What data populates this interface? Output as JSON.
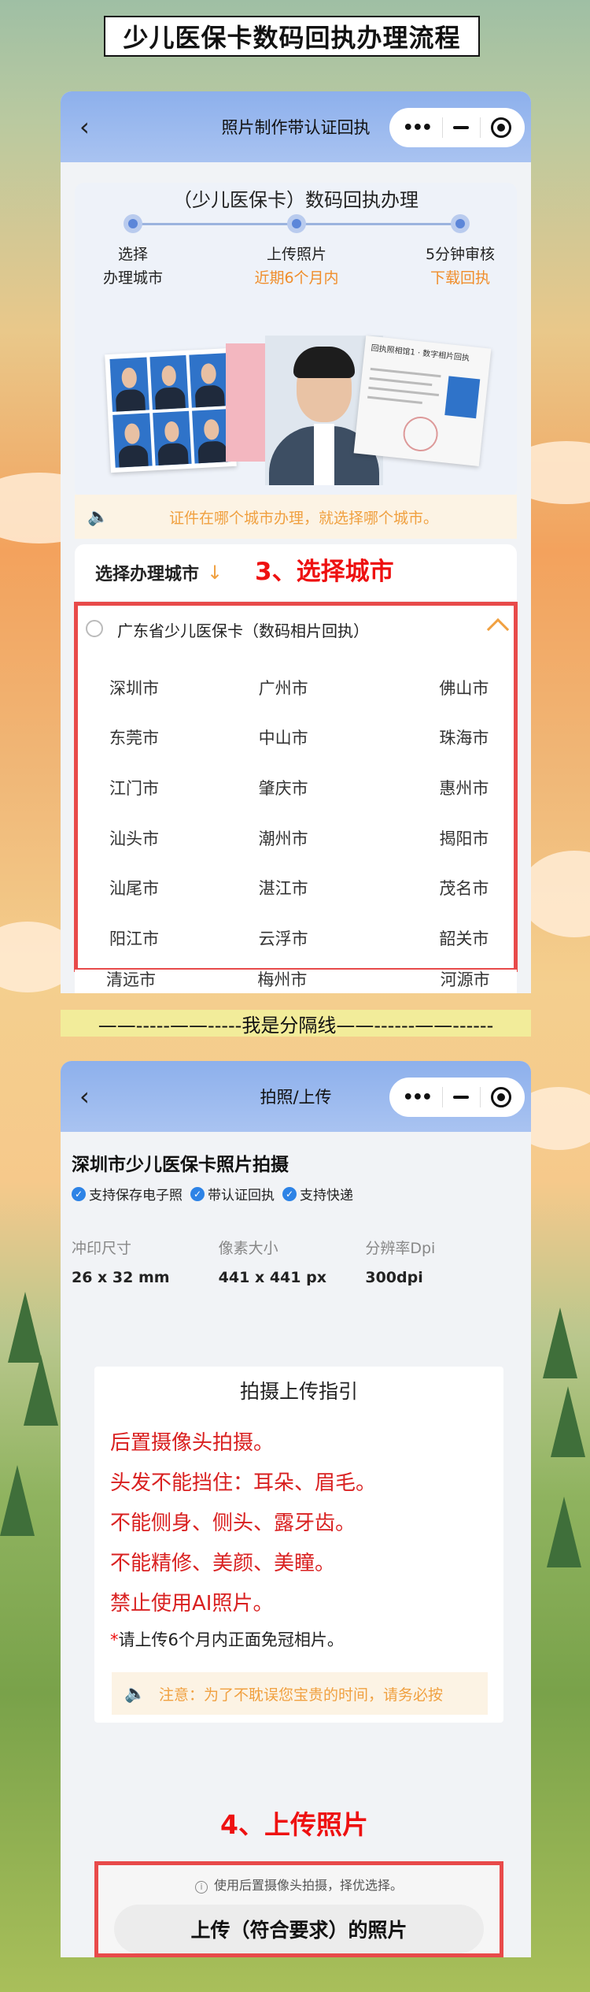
{
  "page_title": "少儿医保卡数码回执办理流程",
  "screen1": {
    "nav_title": "照片制作带认证回执",
    "step_heading": "（少儿医保卡）数码回执办理",
    "steps": [
      {
        "line1": "选择",
        "line2": "办理城市"
      },
      {
        "line1": "上传照片",
        "line2": "近期6个月内"
      },
      {
        "line1": "5分钟审核",
        "line2": "下载回执"
      }
    ],
    "receipt_label": "回执照相馆1 · 数字相片回执",
    "notice": "证件在哪个城市办理，就选择哪个城市。",
    "city_select_label": "选择办理城市",
    "city_select_arrow": "↓",
    "annotation": "3、选择城市",
    "province": "广东省少儿医保卡（数码相片回执）",
    "cities": [
      [
        "深圳市",
        "广州市",
        "佛山市"
      ],
      [
        "东莞市",
        "中山市",
        "珠海市"
      ],
      [
        "江门市",
        "肇庆市",
        "惠州市"
      ],
      [
        "汕头市",
        "潮州市",
        "揭阳市"
      ],
      [
        "汕尾市",
        "湛江市",
        "茂名市"
      ],
      [
        "阳江市",
        "云浮市",
        "韶关市"
      ]
    ],
    "cities_partial": [
      "清远市",
      "梅州市",
      "河源市"
    ]
  },
  "divider": "——-----——-----我是分隔线——------——------",
  "screen2": {
    "nav_title": "拍照/上传",
    "title": "深圳市少儿医保卡照片拍摄",
    "tags": [
      "支持保存电子照",
      "带认证回执",
      "支持快递"
    ],
    "specs": [
      {
        "label": "冲印尺寸",
        "value": "26 x 32 mm"
      },
      {
        "label": "像素大小",
        "value": "441 x 441 px"
      },
      {
        "label": "分辨率Dpi",
        "value": "300dpi"
      }
    ],
    "guide_title": "拍摄上传指引",
    "guide_lines": [
      "后置摄像头拍摄。",
      "头发不能挡住：耳朵、眉毛。",
      "不能侧身、侧头、露牙齿。",
      "不能精修、美颜、美瞳。",
      "禁止使用AI照片。"
    ],
    "guide_small_star": "*",
    "guide_small": "请上传6个月内正面免冠相片。",
    "guide_note": "注意：为了不耽误您宝贵的时间，请务必按",
    "annotation": "4、上传照片",
    "upload_tip": "使用后置摄像头拍摄，择优选择。",
    "upload_button": "上传（符合要求）的照片"
  },
  "colors": {
    "accent_red": "#e84a4a",
    "orange": "#f0a040",
    "nav_blue": "#8db0ec",
    "check_blue": "#2d83e6"
  }
}
